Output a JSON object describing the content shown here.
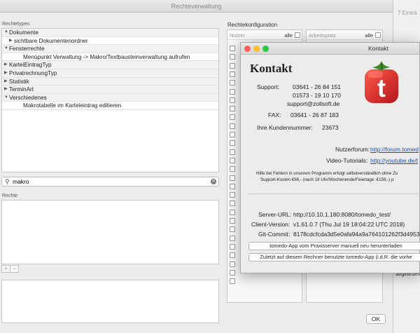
{
  "window": {
    "title": "Rechteverwaltung",
    "ok_label": "OK"
  },
  "left": {
    "rechtetypen_label": "Rechtetypen",
    "tree": [
      {
        "kind": "cat",
        "tri": "▼",
        "label": "Dokumente"
      },
      {
        "kind": "sub",
        "tri": "▶",
        "label": "sichtbare Dokumentenordner"
      },
      {
        "kind": "cat",
        "tri": "▼",
        "label": "Fensterrechte"
      },
      {
        "kind": "leaf",
        "tri": "",
        "label": "Menüpunkt Verwaltung -> Makro/Textbausteinverwaltung aufrufen"
      },
      {
        "kind": "cat",
        "tri": "▶",
        "label": "KarteiEintragTyp"
      },
      {
        "kind": "cat",
        "tri": "▶",
        "label": "PrivatrechnungTyp"
      },
      {
        "kind": "cat",
        "tri": "▶",
        "label": "Statistik"
      },
      {
        "kind": "cat",
        "tri": "▶",
        "label": "TerminArt"
      },
      {
        "kind": "cat",
        "tri": "▼",
        "label": "Verschiedenes"
      },
      {
        "kind": "leaf",
        "tri": "",
        "label": "Makrotabelle im Karteieintrag editieren"
      }
    ],
    "search_value": "makro",
    "rechte_label": "Rechte",
    "plus": "+",
    "minus": "−"
  },
  "right": {
    "config_label": "Rechtekonfiguration",
    "col_nutzer": "Nutzer",
    "col_arbeitsplatz": "Arbeitsplatz",
    "alle": "alle",
    "edge_text": "7 Einträ",
    "edge_text2": "abgearbeit"
  },
  "dialog": {
    "title": "Kontakt",
    "heading": "Kontakt",
    "support_label": "Support:",
    "phone1": "03641 - 26 84 151",
    "phone2": "01573 - 19 10 170",
    "email": "support@zollsoft.de",
    "fax_label": "FAX:",
    "fax": "03641 - 26 87 183",
    "kunden_label": "Ihre Kundennummer:",
    "kunden_nr": "23673",
    "forum_label": "Nutzerforum:",
    "forum_link": "http://forum.tomed",
    "video_label": "Video-Tutorials:",
    "video_link": "http://youtube.de/t",
    "hilfe1": "Hilfe bei Fehlern in unserem Programm erfolgt selbstverständlich ohne Zu",
    "hilfe2": "Support-Kosten €98,- (nach 18 Uhr/Wochenende/Feiertage: €158,-) p",
    "server_label": "Server-URL:",
    "server_val": "http://10.10.1.180:8080/tomedo_test/",
    "client_label": "Client-Version:",
    "client_val": "v1.61.0.7 (Thu Jul 19 18:04:22 UTC 2018)",
    "git_label": "Git-Commit:",
    "git_val": "8178cdcfcda3d5e0afa94a9a764101262f3d4953",
    "btn1": "tomedo-App vom Praxisserver manuell neu herunterladen",
    "btn2": "Zuletzt auf diesem Rechner benutzte tomedo-App (i.d.R. die vorhe",
    "logo_letter": "t",
    "colors": {
      "red": "#ff5f57",
      "yellow": "#febc2e",
      "green": "#28c840",
      "tomato": "#d8262c",
      "leaf": "#3d8a2a"
    }
  }
}
